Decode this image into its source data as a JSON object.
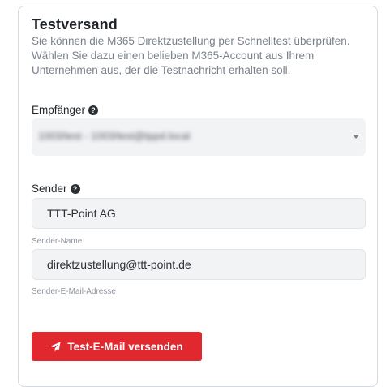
{
  "card": {
    "title": "Testversand",
    "description": "Sie können die M365 Direktzustellung per Schnelltest überprüfen. Wählen Sie dazu einen belieben M365-Account aus Ihrem Unternehmen aus, der die Testnachricht erhalten soll."
  },
  "recipient": {
    "label": "Empfänger",
    "selected_value": "1003/test - 1003/test@tppd.local"
  },
  "sender": {
    "label": "Sender",
    "name_value": "TTT-Point AG",
    "name_hint": "Sender-Name",
    "email_value": "direktzustellung@ttt-point.de",
    "email_hint": "Sender-E-Mail-Adresse"
  },
  "actions": {
    "send_label": "Test-E-Mail versenden"
  },
  "colors": {
    "accent": "#e0282e",
    "input_bg": "#f2f3f5"
  }
}
